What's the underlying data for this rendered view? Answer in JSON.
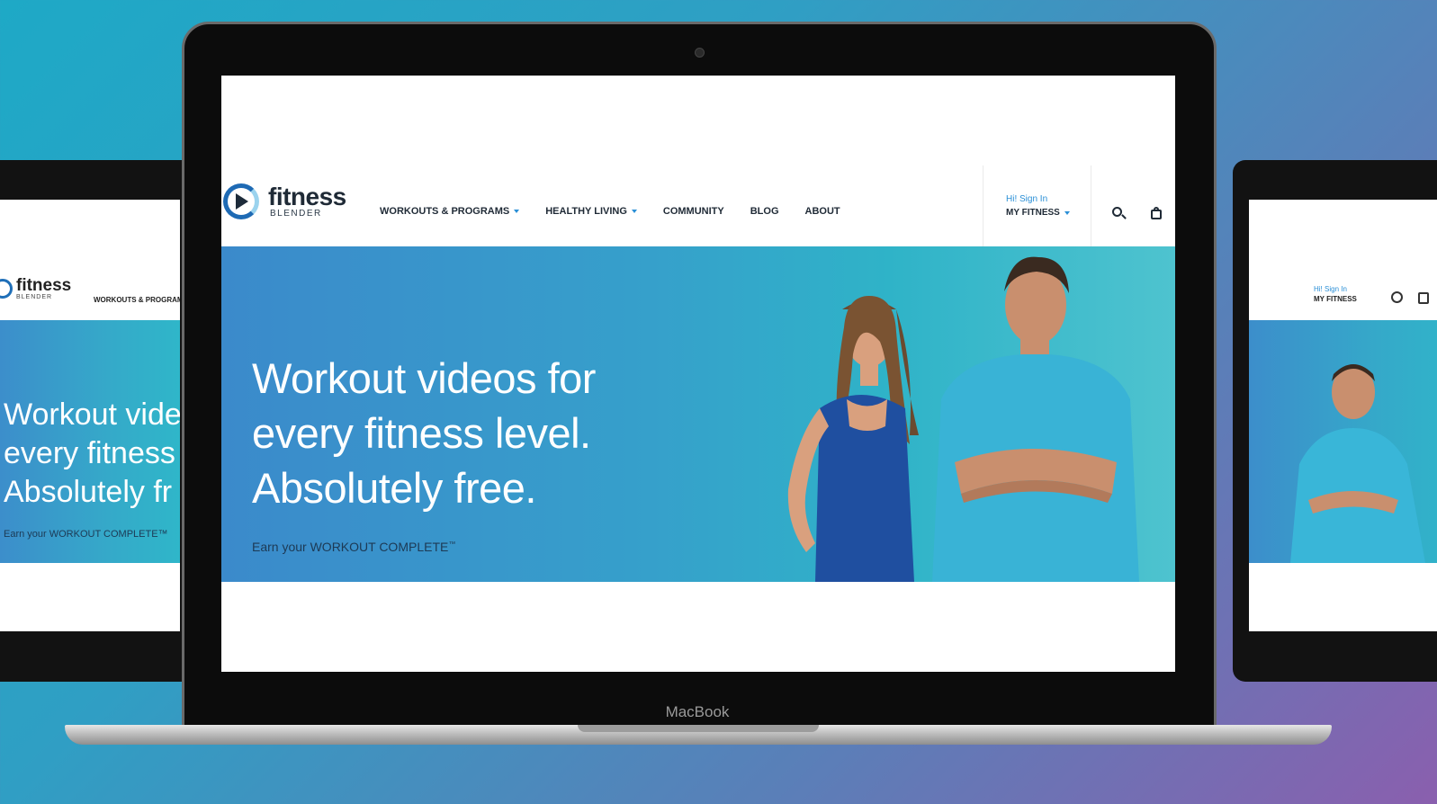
{
  "site": {
    "logo_word": "fitness",
    "logo_sub": "BLENDER",
    "nav": [
      {
        "label": "WORKOUTS & PROGRAMS",
        "dropdown": true
      },
      {
        "label": "HEALTHY LIVING",
        "dropdown": true
      },
      {
        "label": "COMMUNITY",
        "dropdown": false
      },
      {
        "label": "BLOG",
        "dropdown": false
      },
      {
        "label": "ABOUT",
        "dropdown": false
      }
    ],
    "account": {
      "greeting": "Hi! Sign In",
      "my_fitness": "MY FITNESS"
    },
    "icons": {
      "search": "search-icon",
      "cart": "shopping-bag-icon"
    },
    "hero": {
      "headline_lines": [
        "Workout videos for",
        "every fitness level.",
        "Absolutely free."
      ],
      "subtext": "Earn your WORKOUT COMPLETE",
      "subtext_mark": "™"
    },
    "colors": {
      "accent": "#2a8fd6",
      "hero_start": "#3b8acb",
      "hero_end": "#4ec3cf",
      "text_dark": "#1f2a36"
    }
  },
  "device": {
    "brand_label": "MacBook"
  },
  "side_left": {
    "logo_word": "fitness",
    "logo_sub": "BLENDER",
    "nav_text": "WORKOUTS & PROGRAM",
    "headline_lines": [
      "Workout vide",
      "every fitness",
      "Absolutely fr"
    ],
    "subtext": "Earn your WORKOUT COMPLETE™"
  },
  "side_right": {
    "greeting": "Hi! Sign In",
    "my_fitness": "MY FITNESS"
  }
}
